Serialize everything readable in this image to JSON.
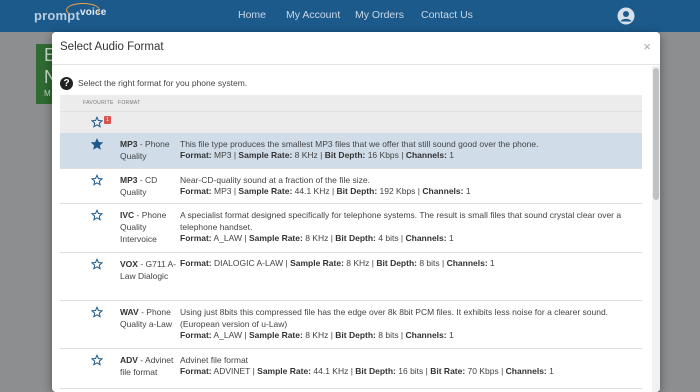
{
  "nav": {
    "logo_part1": "prompt",
    "logo_part2": "voice",
    "links": [
      "Home",
      "My Account",
      "My Orders",
      "Contact Us"
    ]
  },
  "background": {
    "panel_letters": "E N",
    "panel_small": "M"
  },
  "modal": {
    "title": "Select Audio Format",
    "close": "×",
    "prompt": "Select the right format for you phone system.",
    "columns": {
      "favourite": "FAVOURITE",
      "format": "FORMAT"
    },
    "filter_badge": "1",
    "spec_labels": {
      "format": "Format:",
      "rate": "Sample Rate:",
      "depth": "Bit Depth:",
      "bitrate": "Bit Rate:",
      "channels": "Channels:"
    },
    "rows": [
      {
        "code": "MP3",
        "suffix": "- Phone Quality",
        "favourite": true,
        "selected": true,
        "description": "This file type produces the smallest MP3 files that we offer that still sound good over the phone.",
        "format": "MP3",
        "rate": "8 KHz",
        "depth": "16 Kbps",
        "channels": "1"
      },
      {
        "code": "MP3",
        "suffix": "- CD Quality",
        "favourite": false,
        "selected": false,
        "description": "Near-CD-quality sound at a fraction of the file size.",
        "format": "MP3",
        "rate": "44.1 KHz",
        "depth": "192 Kbps",
        "channels": "1"
      },
      {
        "code": "IVC",
        "suffix": "- Phone Quality Intervoice",
        "favourite": false,
        "selected": false,
        "description": "A specialist format designed specifically for telephone systems. The result is small files that sound crystal clear over a telephone handset.",
        "format": "A_LAW",
        "rate": "8 KHz",
        "depth": "4 bits",
        "channels": "1"
      },
      {
        "code": "VOX",
        "suffix": "- G711 A-Law Dialogic",
        "favourite": false,
        "selected": false,
        "description": "",
        "format": "DIALOGIC A-LAW",
        "rate": "8 KHz",
        "depth": "8 bits",
        "channels": "1"
      },
      {
        "code": "WAV",
        "suffix": "- Phone Quality a-Law",
        "favourite": false,
        "selected": false,
        "description": "Using just 8bits this compressed file has the edge over 8k 8bit PCM files. It exhibits less noise for a clearer sound. (European version of u-Law)",
        "format": "A_LAW",
        "rate": "8 KHz",
        "depth": "8 bits",
        "channels": "1"
      },
      {
        "code": "ADV",
        "suffix": "- Advinet file format",
        "favourite": false,
        "selected": false,
        "description": "Advinet file format",
        "format": "ADVINET",
        "rate": "44.1 KHz",
        "depth": "16 bits",
        "bitrate": "70 Kbps",
        "channels": "1"
      }
    ]
  },
  "colors": {
    "nav": "#1c5a8c",
    "selected_row": "#d0dde9",
    "star": "#1c5a8c",
    "badge": "#d9534f"
  }
}
